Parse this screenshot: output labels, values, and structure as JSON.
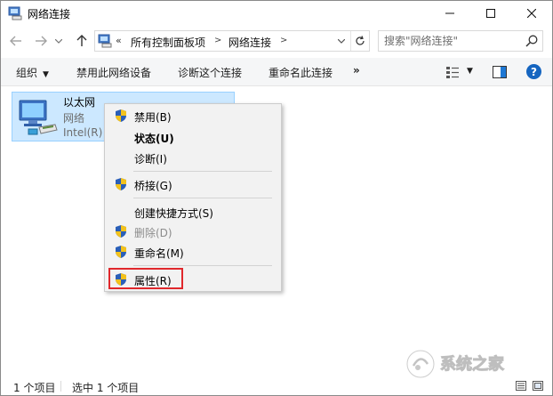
{
  "window": {
    "title": "网络连接"
  },
  "title_controls": {
    "minimize": "—",
    "maximize": "☐",
    "close": "✕"
  },
  "address_bar": {
    "chevron": "«",
    "crumbs": [
      "所有控制面板项",
      "网络连接"
    ]
  },
  "search": {
    "placeholder": "搜索\"网络连接\""
  },
  "command_bar": {
    "organize": "组织",
    "disable_device": "禁用此网络设备",
    "diagnose": "诊断这个连接",
    "rename": "重命名此连接",
    "more": "»",
    "help": "?"
  },
  "adapter": {
    "name": "以太网",
    "status": "网络",
    "device": "Intel(R)"
  },
  "context_menu": {
    "items": [
      {
        "label": "禁用(B)",
        "shield": true,
        "bold": false,
        "disabled": false
      },
      {
        "label": "状态(U)",
        "shield": false,
        "bold": true,
        "disabled": false
      },
      {
        "label": "诊断(I)",
        "shield": false,
        "bold": false,
        "disabled": false
      },
      {
        "label": "桥接(G)",
        "shield": true,
        "bold": false,
        "disabled": false
      },
      {
        "label": "创建快捷方式(S)",
        "shield": false,
        "bold": false,
        "disabled": false
      },
      {
        "label": "删除(D)",
        "shield": true,
        "bold": false,
        "disabled": true
      },
      {
        "label": "重命名(M)",
        "shield": true,
        "bold": false,
        "disabled": false
      },
      {
        "label": "属性(R)",
        "shield": true,
        "bold": false,
        "disabled": false
      }
    ],
    "highlight_color": "#e0282c"
  },
  "status_bar": {
    "count": "1 个项目",
    "selected": "选中 1 个项目"
  },
  "watermark": {
    "text": "系统之家"
  },
  "colors": {
    "selection_bg": "#cce8ff",
    "selection_border": "#99d1ff",
    "menu_bg": "#f2f2f2",
    "help_blue": "#1565c0",
    "shield_blue": "#2a5fb8",
    "shield_yellow": "#f3c21c"
  }
}
